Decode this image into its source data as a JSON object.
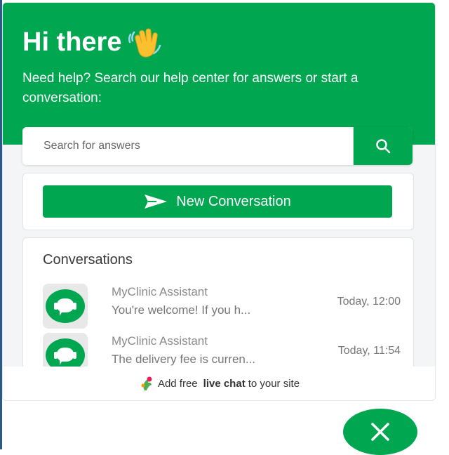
{
  "header": {
    "title": "Hi there",
    "subtitle": "Need help? Search our help center for answers or start a conversation:"
  },
  "search": {
    "placeholder": "Search for answers"
  },
  "new_conversation": {
    "label": "New Conversation"
  },
  "conversations": {
    "heading": "Conversations",
    "items": [
      {
        "name": "MyClinic Assistant",
        "message": "You're welcome! If you h...",
        "time": "Today, 12:00"
      },
      {
        "name": "MyClinic Assistant",
        "message": "The delivery fee is curren...",
        "time": "Today, 11:54"
      }
    ]
  },
  "footer": {
    "prefix": "Add free",
    "bold": "live chat",
    "suffix": "to your site"
  },
  "colors": {
    "accent": "#00a650",
    "background": "#f4f5f7"
  },
  "icons": {
    "wave": "waving-hand-icon",
    "search": "search-icon",
    "send": "send-icon",
    "avatar": "chat-bubble-icon",
    "footer_logo": "brand-logo-icon",
    "close": "close-icon"
  }
}
